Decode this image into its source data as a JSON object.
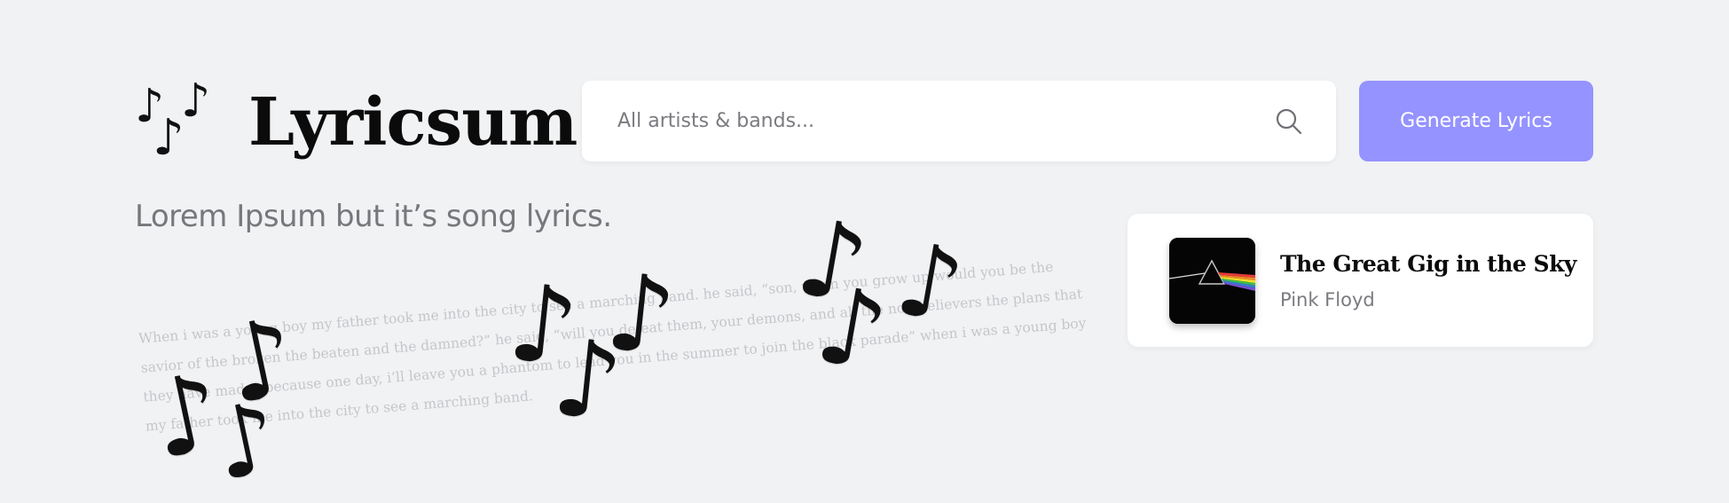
{
  "header": {
    "logo_title": "Lyricsum",
    "tagline": "Lorem Ipsum but it’s song lyrics."
  },
  "search": {
    "placeholder": "All artists & bands...",
    "icon": "search-icon"
  },
  "generate_button": {
    "label": "Generate Lyrics",
    "color": "#9593ff"
  },
  "lyrics_preview": "When i was a young boy my father took me into the city to see a marching band. he said, “son, when you grow up would you be the savior of the broken the beaten and the damned?” he said, “will you defeat them, your demons, and all the non-believers the plans that they have made? because one day, i’ll leave you a phantom to lead you in the summer to join the black parade” when i was a young boy my father took me into the city to see a marching band.",
  "song_card": {
    "title": "The Great Gig in the Sky",
    "artist": "Pink Floyd",
    "album_art": "prism-album-art"
  },
  "decorations": {
    "glyph": "♪"
  }
}
